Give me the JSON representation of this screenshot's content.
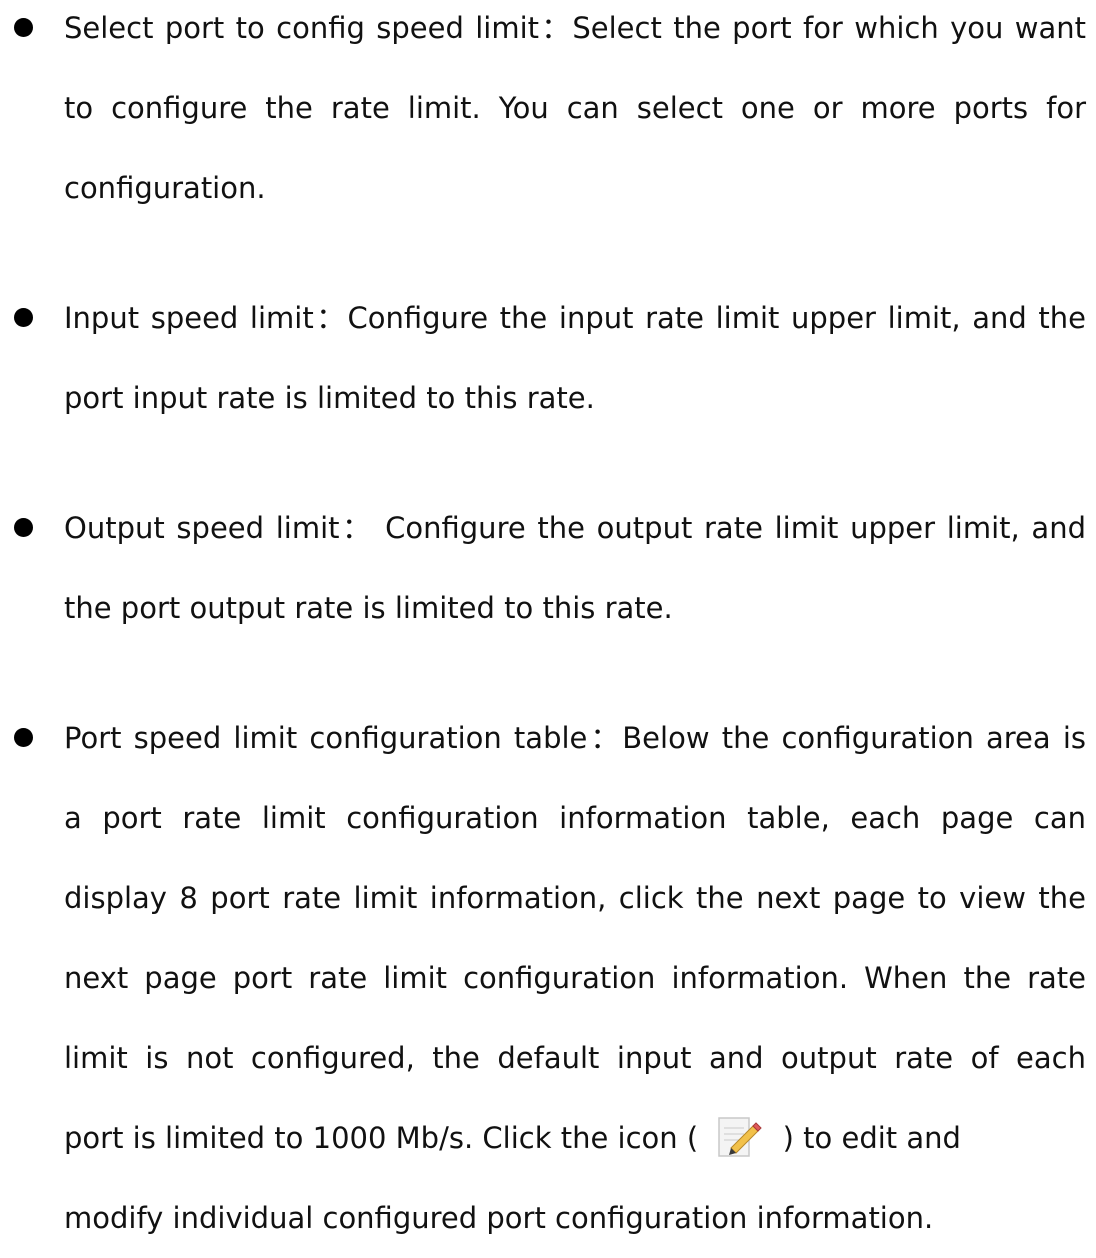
{
  "items": [
    {
      "lines": [
        "Select port to config speed limit：Select the port for which you want",
        "to configure the rate limit. You can select one or more ports for",
        "configuration."
      ]
    },
    {
      "lines": [
        "Input speed limit：Configure the input rate limit upper limit, and the",
        "port input rate is limited to this rate."
      ]
    },
    {
      "lines": [
        "Output speed limit： Configure the output rate limit upper limit, and",
        "the port output rate is limited to this rate."
      ]
    },
    {
      "lines": [
        "Port speed limit configuration table：Below the configuration area is",
        "a port rate limit configuration information table, each page can",
        "display 8 port rate limit information, click the next page to view the",
        "next page port rate limit configuration information. When the rate",
        "limit is not configured, the default input and output rate of each"
      ],
      "icon_line_before": "port is limited to 1000 Mb/s. Click the icon (",
      "icon_name": "edit-pencil-icon",
      "icon_line_after": ")  to edit and",
      "final_line": "modify individual configured port configuration information."
    }
  ]
}
